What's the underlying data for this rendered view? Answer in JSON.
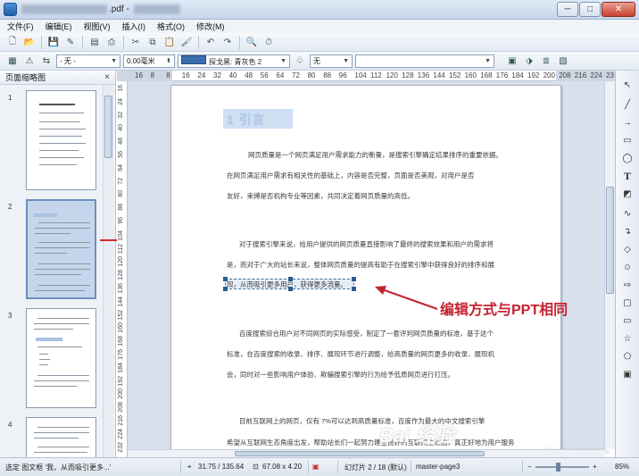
{
  "window": {
    "title_suffix": ".pdf -",
    "controls": [
      "─",
      "□",
      "✕"
    ]
  },
  "menu": [
    "文件(F)",
    "编辑(E)",
    "视图(V)",
    "插入(I)",
    "格式(O)",
    "修改(M)"
  ],
  "toolbar2": {
    "line_style": "- 无 -",
    "line_width": "0.00毫米",
    "color_prefix": "探戈黑: 青灰色 2",
    "fill": "无"
  },
  "panel": {
    "title": "页面缩略图",
    "close": "×",
    "page_numbers": [
      "1",
      "2",
      "3",
      "4"
    ]
  },
  "ruler": {
    "h_ticks": [
      "16",
      "8",
      "8",
      "16",
      "24",
      "32",
      "40",
      "48",
      "56",
      "64",
      "72",
      "80",
      "88",
      "96",
      "104",
      "112",
      "120",
      "128",
      "136",
      "144",
      "152",
      "160",
      "168",
      "176",
      "184",
      "192",
      "200",
      "208",
      "216",
      "224",
      "23"
    ],
    "v_ticks": [
      "16",
      "24",
      "32",
      "40",
      "48",
      "56",
      "64",
      "72",
      "80",
      "88",
      "96",
      "104",
      "112",
      "120",
      "128",
      "136",
      "144",
      "152",
      "160",
      "168",
      "176",
      "184",
      "192",
      "200",
      "208",
      "216",
      "224",
      "232"
    ]
  },
  "document": {
    "heading": "1 引言",
    "paragraphs": [
      "网页质量是一个网页满足用户需求能力的衡量，是搜索引擎确定结果排序的重要依据。",
      "在网页满足用户需求有相关性的基础上，内容是否完整，页面是否美观，对用户是否",
      "友好，束缚是否机构专业等因素，共同决定着网页质量的高低。",
      "对于搜索引擎来说，给用户提供的网页质量直接影响了最终的搜索效果和用户的需求将",
      "是，而对于广大的站长来说，整体网页质量的提高有助于在搜索引擎中获得良好的排序和展",
      "现，从而吸引更多用户，获得更多流量。",
      "百度搜索综合用户对不同网页的实际感受，制定了一套评判网页质量的标准，基于这个",
      "标准，在百度搜索的收录、排序、展现环节进行调整，给高质量的网页更多的收录、展现机",
      "会，同时对一些影响用户体验、欺骗搜索引擎的行为给予低质网页进行打压。",
      "目前互联网上的网页，仅有 7%可以达到高质量标准，百度作为最大的中文搜索引擎",
      "希望从互联网生态角度出发，帮助站长们一起努力建立良好的互联网生态圈，真正好地为用户服务"
    ],
    "annotation": "编辑方式与PPT相同"
  },
  "watermark": {
    "text": "Bai 经验",
    "sub": "jingyan.baidu.com"
  },
  "status": {
    "selection": "选定 图文框 '我，从而吸引更多...'",
    "position": "31.75 / 135.64",
    "size": "67.08 x 4.20",
    "slide": "幻灯片 2 / 18 (默认)",
    "master": "master-page3",
    "minus": "−",
    "plus": "+",
    "zoom": "85%"
  },
  "colors": {
    "accent": "#3b6fb0",
    "annotation": "#c42430",
    "selected_thumb": "#c5d6ec"
  }
}
